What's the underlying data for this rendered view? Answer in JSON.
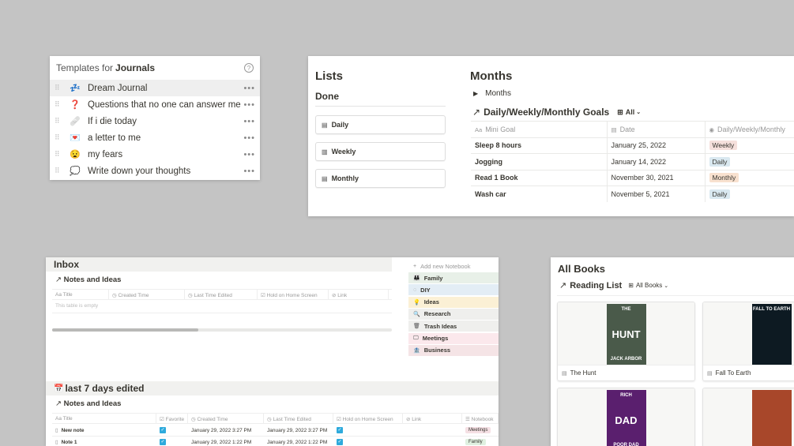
{
  "templates": {
    "prefix": "Templates for",
    "name": "Journals",
    "help_icon": "?",
    "items": [
      {
        "emoji": "💤",
        "label": "Dream Journal"
      },
      {
        "emoji": "❓",
        "label": "Questions that no one can answer me"
      },
      {
        "emoji": "🩹",
        "label": "If i die today"
      },
      {
        "emoji": "💌",
        "label": "a letter to me"
      },
      {
        "emoji": "😧",
        "label": "my fears"
      },
      {
        "emoji": "💭",
        "label": "Write down your thoughts"
      }
    ],
    "more": "•••"
  },
  "lists": {
    "title": "Lists",
    "done": "Done",
    "buttons": [
      {
        "icon": "calendar-icon",
        "glyph": "▤",
        "label": "Daily"
      },
      {
        "icon": "columns-icon",
        "glyph": "▥",
        "label": "Weekly"
      },
      {
        "icon": "calendar-icon",
        "glyph": "▤",
        "label": "Monthly"
      }
    ]
  },
  "months": {
    "title": "Months",
    "toggle_arrow": "▶",
    "toggle_label": "Months",
    "link_arrow": "↗",
    "db_title": "Daily/Weekly/Monthly Goals",
    "view_icon": "⊞",
    "view_label": "All",
    "columns": [
      {
        "icon": "Aa",
        "label": "Mini Goal"
      },
      {
        "icon": "▤",
        "label": "Date"
      },
      {
        "icon": "◉",
        "label": "Daily/Weekly/Monthly"
      }
    ],
    "rows": [
      {
        "goal": "Sleep 8 hours",
        "date": "January 25, 2022",
        "freq": "Weekly",
        "color": "#f5e0dc"
      },
      {
        "goal": "Jogging",
        "date": "January 14, 2022",
        "freq": "Daily",
        "color": "#d9e8f0"
      },
      {
        "goal": "Read 1 Book",
        "date": "November 30, 2021",
        "freq": "Monthly",
        "color": "#f8e1cf"
      },
      {
        "goal": "Wash car",
        "date": "November 5, 2021",
        "freq": "Daily",
        "color": "#d9e8f0"
      }
    ]
  },
  "inbox": {
    "title": "Inbox",
    "sub1": "Notes and Ideas",
    "cols1": [
      "Aa Title",
      "◷ Created Time",
      "◷ Last Time Edited",
      "☑ Hold on Home Screen",
      "⊘ Link"
    ],
    "empty": "This table is empty",
    "section2": "last 7 days edited",
    "section2_icon": "📅",
    "sub2": "Notes and Ideas",
    "cols2": [
      "Aa Title",
      "☑ Favorite",
      "◷ Created Time",
      "◷ Last Time Edited",
      "☑ Hold on Home Screen",
      "⊘ Link",
      "☰ Notebook"
    ],
    "notes": [
      {
        "title": "New note",
        "created": "January 29, 2022 3:27 PM",
        "edited": "January 29, 2022 3:27 PM",
        "notebook": "Meetings",
        "nb_color": "#f5e0e4"
      },
      {
        "title": "Note 1",
        "created": "January 29, 2022 1:22 PM",
        "edited": "January 29, 2022 1:22 PM",
        "notebook": "Family",
        "nb_color": "#dff0e0"
      }
    ],
    "add_notebook": "Add new Notebook",
    "notebooks": [
      {
        "icon": "family-icon",
        "glyph": "👪",
        "label": "Family",
        "bg": "#e8f0e8"
      },
      {
        "icon": "diy-icon",
        "glyph": "◌",
        "label": "DIY",
        "bg": "#e3edf5"
      },
      {
        "icon": "bulb-icon",
        "glyph": "💡",
        "label": "Ideas",
        "bg": "#fbf0d5"
      },
      {
        "icon": "search-icon",
        "glyph": "🔍",
        "label": "Research",
        "bg": "#efefed"
      },
      {
        "icon": "trash-icon",
        "glyph": "🗑",
        "label": "Trash Ideas",
        "bg": "#efefed"
      },
      {
        "icon": "meetings-icon",
        "glyph": "🖵",
        "label": "Meetings",
        "bg": "#fbe8ec"
      },
      {
        "icon": "business-icon",
        "glyph": "🏦",
        "label": "Business",
        "bg": "#f5e4e6"
      }
    ]
  },
  "books": {
    "title": "All Books",
    "link_arrow": "↗",
    "sub": "Reading List",
    "view_icon": "⊞",
    "view_label": "All Books",
    "cards": [
      {
        "caption": "The Hunt",
        "cover_top": "THE",
        "cover_mid": "HUNT",
        "cover_bottom": "JACK ARBOR",
        "bg": "#4a5a4a"
      },
      {
        "caption": "Fall To Earth",
        "cover_top": "FALL TO EARTH",
        "cover_mid": "",
        "cover_bottom": "",
        "bg": "#0d1a22"
      },
      {
        "caption": "",
        "cover_top": "RICH",
        "cover_mid": "DAD",
        "cover_bottom": "POOR DAD",
        "bg": "#5a1f6e"
      },
      {
        "caption": "",
        "cover_top": "",
        "cover_mid": "",
        "cover_bottom": "",
        "bg": "#a8472a"
      }
    ]
  }
}
